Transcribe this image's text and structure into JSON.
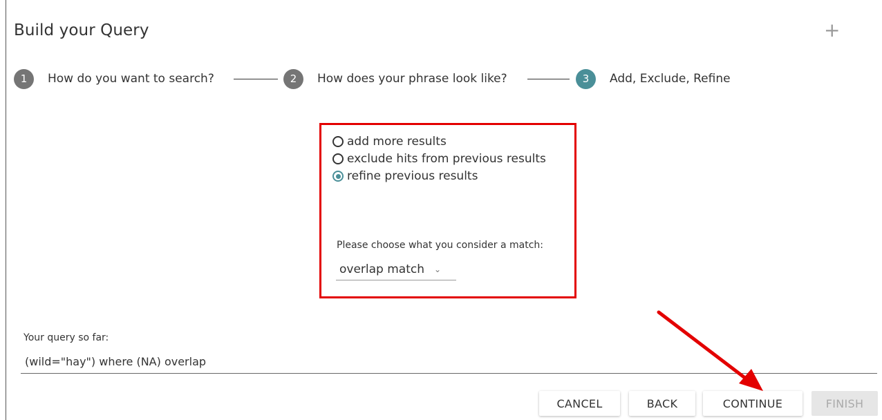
{
  "header": {
    "title": "Build your Query",
    "add_icon": "plus-icon"
  },
  "stepper": {
    "steps": [
      {
        "number": "1",
        "label": "How do you want to search?",
        "state": "done"
      },
      {
        "number": "2",
        "label": "How does your phrase look like?",
        "state": "done"
      },
      {
        "number": "3",
        "label": "Add, Exclude, Refine",
        "state": "active"
      }
    ]
  },
  "options": {
    "items": [
      {
        "label": "add more results",
        "checked": false
      },
      {
        "label": "exclude hits from previous results",
        "checked": false
      },
      {
        "label": "refine previous results",
        "checked": true
      }
    ],
    "match_label": "Please choose what you consider a match:",
    "match_select": {
      "value": "overlap match"
    }
  },
  "query": {
    "label": "Your query so far:",
    "value": "(wild=\"hay\") where (NA) overlap"
  },
  "actions": {
    "cancel": "CANCEL",
    "back": "BACK",
    "continue": "CONTINUE",
    "finish": "FINISH"
  },
  "colors": {
    "accent": "#4a8f98",
    "step_done": "#757575",
    "highlight": "#e30000"
  }
}
